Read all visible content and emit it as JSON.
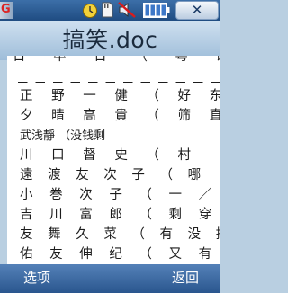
{
  "status_bar": {
    "signal_letter": "G",
    "icons": [
      "signal-icon",
      "alarm-icon",
      "memory-card-icon",
      "mute-icon",
      "battery-icon",
      "close-icon"
    ],
    "close_label": "✕"
  },
  "document": {
    "title": "搞笑.doc",
    "lines": [
      "日 卒 日 （ 粤 语",
      "－－－－－－－－－－－－－－",
      "正 野 一 健 （ 好 东 西",
      "夕 晴 高 貴 （ 筛 直 高",
      "武浅靜 （没钱剩",
      "川 口 督 史 （ 村",
      "遠 渡 友 次 子 （ 哪",
      "小 巻 次 子 （ 一 ／",
      "吉 川 富 郎 （ 剩 穿 裤",
      "友 舞 久 菜 （ 有 没 搞",
      "佑 友 伸 纪 （ 又 有"
    ]
  },
  "softkeys": {
    "left_label": "选项",
    "right_label": "返回"
  },
  "colors": {
    "status_bar": "#2a5a93",
    "title_bar": "#b9cfe3",
    "page": "#ffffff",
    "softkey_text": "#ffffff"
  }
}
